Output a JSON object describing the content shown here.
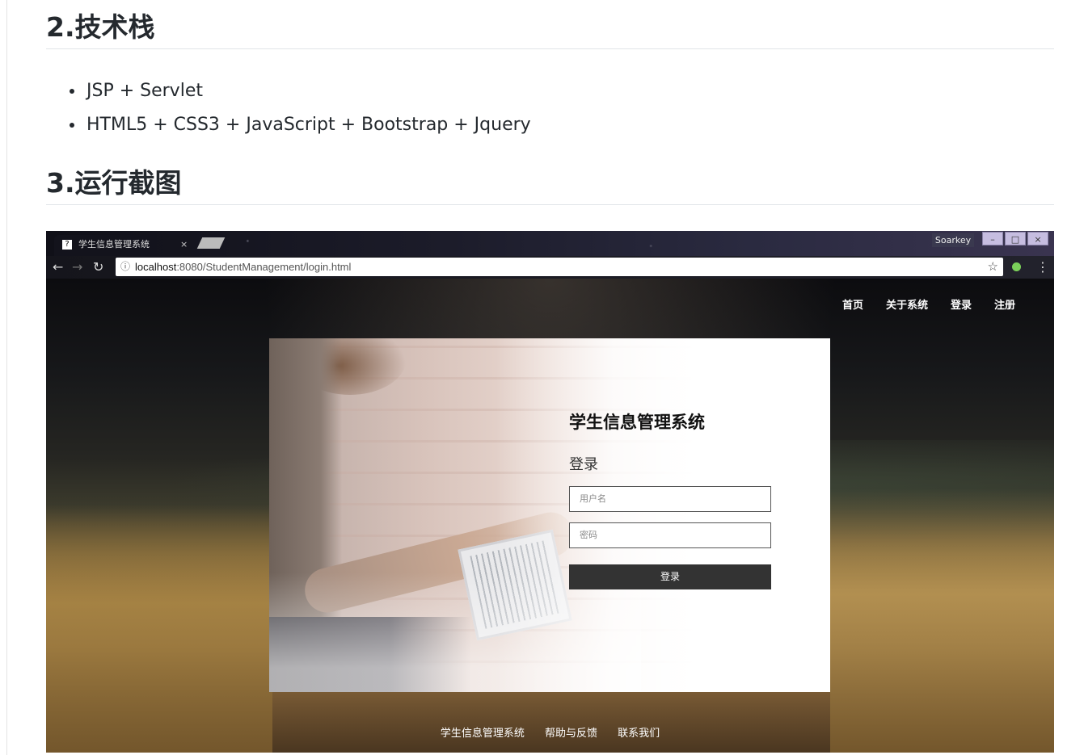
{
  "doc": {
    "section2_title": "2.技术栈",
    "tech_stack": [
      "JSP + Servlet",
      "HTML5 + CSS3 + JavaScript + Bootstrap + Jquery"
    ],
    "section3_title": "3.运行截图"
  },
  "browser": {
    "tab_title": "学生信息管理系统",
    "tab_close": "×",
    "favicon": "?",
    "profile_name": "Soarkey",
    "window_buttons": [
      "–",
      "□",
      "×"
    ],
    "url_info_glyph": "ⓘ",
    "url_host": "localhost",
    "url_path": ":8080/StudentManagement/login.html",
    "icons": [
      "back-arrow-icon",
      "forward-arrow-icon",
      "reload-icon",
      "info-icon",
      "star-icon",
      "extension-icon",
      "menu-icon"
    ]
  },
  "site": {
    "nav": [
      "首页",
      "关于系统",
      "登录",
      "注册"
    ],
    "system_title": "学生信息管理系统",
    "login_heading": "登录",
    "username_placeholder": "用户名",
    "password_placeholder": "密码",
    "login_button": "登录",
    "footer": [
      "学生信息管理系统",
      "帮助与反馈",
      "联系我们"
    ]
  }
}
